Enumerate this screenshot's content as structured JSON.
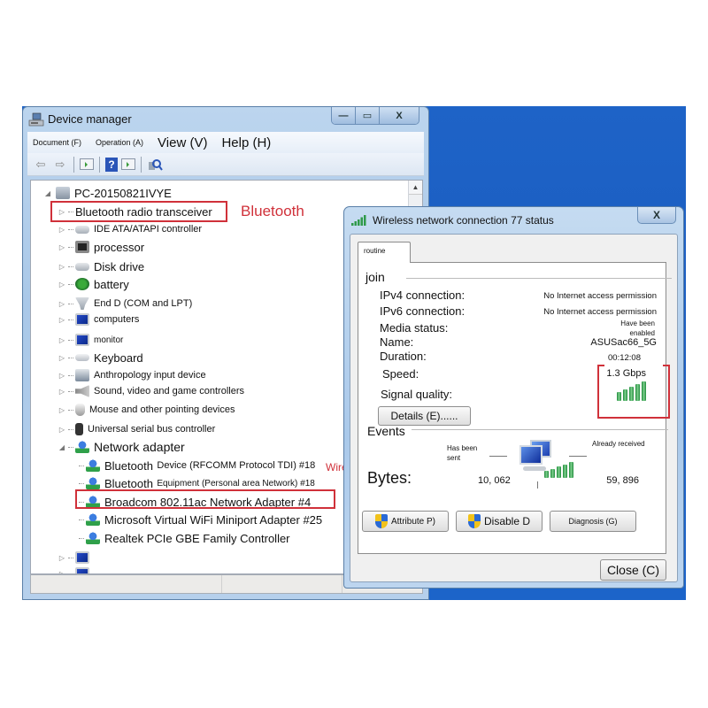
{
  "device_manager": {
    "title": "Device manager",
    "caption_buttons": {
      "minimize": "—",
      "maximize": "▭",
      "close": "X"
    },
    "menu": [
      {
        "label": "Document (F)",
        "size": "small"
      },
      {
        "label": "Operation (A)",
        "size": "small"
      },
      {
        "label": "View (V)",
        "size": "big"
      },
      {
        "label": "Help (H)",
        "size": "big"
      }
    ],
    "toolbar": {
      "back": "back-arrow-icon",
      "forward": "forward-arrow-icon",
      "show_hide_tree": "show-hide-console-tree-icon",
      "help": "?",
      "action_pane": "show-hide-action-pane-icon",
      "scan": "scan-hardware-changes-icon"
    },
    "tree": {
      "root": "PC-20150821IVYE",
      "categories": [
        {
          "label": "Bluetooth radio transceiver",
          "icon": "bluetooth-icon",
          "expanded": false,
          "highlighted": true
        },
        {
          "label": "IDE ATA/ATAPI controller",
          "icon": "ide-controller-icon",
          "expanded": false
        },
        {
          "label": "processor",
          "icon": "processor-icon",
          "expanded": false
        },
        {
          "label": "Disk drive",
          "icon": "disk-drive-icon",
          "expanded": false
        },
        {
          "label": "battery",
          "icon": "battery-icon",
          "expanded": false
        },
        {
          "label": "End D (COM and LPT)",
          "icon": "port-icon",
          "expanded": false
        },
        {
          "label": "computers",
          "icon": "computer-icon",
          "expanded": false
        },
        {
          "label": "monitor",
          "icon": "monitor-icon",
          "expanded": false
        },
        {
          "label": "Keyboard",
          "icon": "keyboard-icon",
          "expanded": false
        },
        {
          "label": "Anthropology input device",
          "icon": "hid-icon",
          "expanded": false
        },
        {
          "label": "Sound, video and game controllers",
          "icon": "speaker-icon",
          "expanded": false
        },
        {
          "label": "Mouse and other pointing devices",
          "icon": "mouse-icon",
          "expanded": false
        },
        {
          "label": "Universal serial bus controller",
          "icon": "usb-icon",
          "expanded": false
        },
        {
          "label": "Network adapter",
          "icon": "network-adapter-icon",
          "expanded": true
        }
      ],
      "network_adapters": [
        {
          "label_strong": "Bluetooth",
          "label_rest": "Device (RFCOMM Protocol TDI) #18"
        },
        {
          "label_strong": "Bluetooth",
          "label_rest": "Equipment (Personal area Network) #18"
        },
        {
          "label_strong": "Broadcom 802.11ac Network Adapter #4",
          "label_rest": "",
          "highlighted": true
        },
        {
          "label_strong": "Microsoft Virtual WiFi Miniport Adapter #25",
          "label_rest": ""
        },
        {
          "label_strong": "Realtek PCIe GBE Family Controller",
          "label_rest": ""
        }
      ]
    }
  },
  "annotations": {
    "bluetooth": "Bluetooth",
    "wireless": "Wireless",
    "color": "#d0313a"
  },
  "wireless_status": {
    "title": "Wireless network connection 77 status",
    "close_glyph": "X",
    "tab": "routine",
    "connection": {
      "heading": "join",
      "rows": [
        {
          "label": "IPv4 connection:",
          "value": "No Internet access permission"
        },
        {
          "label": "IPv6 connection:",
          "value": "No Internet access permission"
        },
        {
          "label": "Media status:",
          "value": "Have been enabled"
        },
        {
          "label": "Name:",
          "value": "ASUSac66_5G"
        },
        {
          "label": "Duration:",
          "value": "00:12:08"
        },
        {
          "label": "Speed:",
          "value": "1.3 Gbps"
        },
        {
          "label": "Signal quality:",
          "value": "5 of 5 bars"
        }
      ],
      "signal_bars": 5,
      "signal_bars_max": 5,
      "details_button": "Details (E)......"
    },
    "activity": {
      "heading": "Events",
      "sent_label": "Has been sent",
      "received_label": "Already received",
      "bytes_label": "Bytes:",
      "bytes_sent": "10, 062",
      "bytes_received": "59, 896"
    },
    "buttons": {
      "properties": "Attribute P)",
      "disable": "Disable D",
      "diagnose": "Diagnosis (G)",
      "close": "Close (C)"
    },
    "accent": "#2f9a4a"
  }
}
